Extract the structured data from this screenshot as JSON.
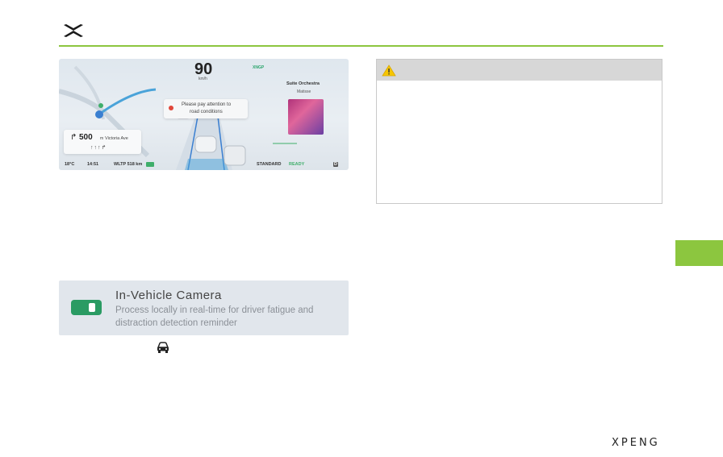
{
  "header": {
    "logo_icon": "xpeng-x-logo-icon",
    "rule_color": "#8cc63f"
  },
  "cluster": {
    "speed": "90",
    "speed_unit": "km/h",
    "gear_tag": "XNGP",
    "alert_line1": "Please pay attention to",
    "alert_line2": "road conditions",
    "song_title": "Suite Orchestra",
    "song_artist": "Matisse",
    "nav_distance": "500",
    "nav_unit": "m",
    "nav_street": "Victoria Ave",
    "nav_lanes": "↑↑↑↱",
    "nav_turn_icon": "turn-right-icon",
    "temperature": "18°C",
    "time": "14:51",
    "range": "WLTP 518 km",
    "drive_mode": "STANDARD",
    "ready": "READY",
    "gear": "D"
  },
  "warning": {
    "icon": "warning-triangle-icon",
    "header_color": "#d7d7d7"
  },
  "camera_card": {
    "title": "In-Vehicle Camera",
    "description_line1": "Process locally in real-time for driver fatigue and",
    "description_line2": "distraction detection reminder",
    "toggle_on": true,
    "toggle_color": "#2a9b63"
  },
  "misc": {
    "car_icon": "car-icon",
    "side_tab_color": "#8cc63f",
    "brand": "XPENG"
  }
}
